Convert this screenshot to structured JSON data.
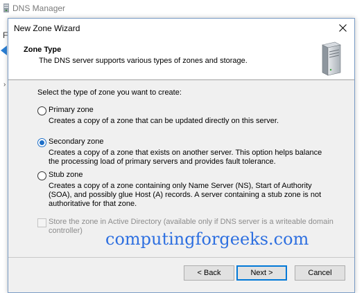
{
  "background_window": {
    "title": "DNS Manager",
    "menu_letter": "F",
    "tree_glyph": "›"
  },
  "dialog": {
    "title": "New Zone Wizard",
    "header": {
      "title": "Zone Type",
      "subtitle": "The DNS server supports various types of zones and storage."
    },
    "prompt": "Select the type of zone you want to create:",
    "options": [
      {
        "label": "Primary zone",
        "description": "Creates a copy of a zone that can be updated directly on this server.",
        "checked": false
      },
      {
        "label": "Secondary zone",
        "description": "Creates a copy of a zone that exists on another server. This option helps balance the processing load of primary servers and provides fault tolerance.",
        "checked": true
      },
      {
        "label": "Stub zone",
        "description": "Creates a copy of a zone containing only Name Server (NS), Start of Authority (SOA), and possibly glue Host (A) records. A server containing a stub zone is not authoritative for that zone.",
        "checked": false
      }
    ],
    "store_option": {
      "label": "Store the zone in Active Directory (available only if DNS server is a writeable domain controller)",
      "checked": false,
      "disabled": true
    },
    "watermark": "computingforgeeks.com",
    "buttons": {
      "back": "< Back",
      "next": "Next >",
      "cancel": "Cancel"
    }
  },
  "colors": {
    "accent": "#0078d7",
    "radio_selected": "#1e6fc8",
    "watermark": "#2d6fe0"
  },
  "icons": [
    "dns-manager-app-icon",
    "back-arrow-icon",
    "close-icon",
    "server-icon"
  ]
}
